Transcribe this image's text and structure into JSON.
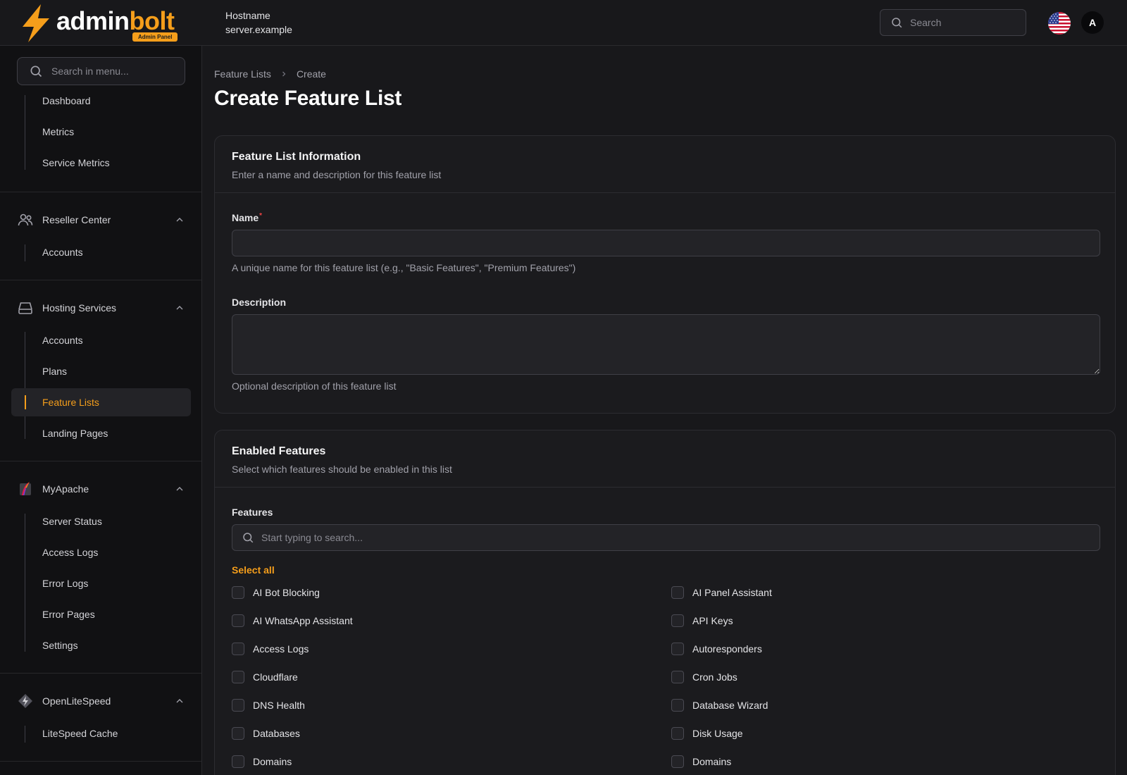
{
  "brand": {
    "word_white": "admin",
    "word_orange": "bolt",
    "badge": "Admin Panel"
  },
  "header": {
    "hostname_label": "Hostname",
    "hostname_value": "server.example",
    "search_placeholder": "Search",
    "avatar_initial": "A"
  },
  "sidebar": {
    "search_placeholder": "Search in menu...",
    "top_items": [
      "Dashboard",
      "Metrics",
      "Service Metrics"
    ],
    "groups": [
      {
        "label": "Reseller Center",
        "items": [
          "Accounts"
        ]
      },
      {
        "label": "Hosting Services",
        "items": [
          "Accounts",
          "Plans",
          "Feature Lists",
          "Landing Pages"
        ],
        "active": "Feature Lists"
      },
      {
        "label": "MyApache",
        "items": [
          "Server Status",
          "Access Logs",
          "Error Logs",
          "Error Pages",
          "Settings"
        ]
      },
      {
        "label": "OpenLiteSpeed",
        "items": [
          "LiteSpeed Cache"
        ]
      }
    ]
  },
  "breadcrumb": [
    "Feature Lists",
    "Create"
  ],
  "page_title": "Create Feature List",
  "info_card": {
    "title": "Feature List Information",
    "subtitle": "Enter a name and description for this feature list",
    "name_label": "Name",
    "required_mark": "*",
    "name_value": "",
    "name_help": "A unique name for this feature list (e.g., \"Basic Features\", \"Premium Features\")",
    "description_label": "Description",
    "description_value": "",
    "description_help": "Optional description of this feature list"
  },
  "features_card": {
    "title": "Enabled Features",
    "subtitle": "Select which features should be enabled in this list",
    "features_label": "Features",
    "search_placeholder": "Start typing to search...",
    "select_all": "Select all",
    "left_column": [
      "AI Bot Blocking",
      "AI WhatsApp Assistant",
      "Access Logs",
      "Cloudflare",
      "DNS Health",
      "Databases",
      "Domains"
    ],
    "right_column": [
      "AI Panel Assistant",
      "API Keys",
      "Autoresponders",
      "Cron Jobs",
      "Database Wizard",
      "Disk Usage",
      "Domains"
    ]
  },
  "colors": {
    "accent": "#f59e1b",
    "background": "#18181b",
    "sidebar": "#111113",
    "card": "#1b1b1e",
    "required": "#ef4444"
  }
}
